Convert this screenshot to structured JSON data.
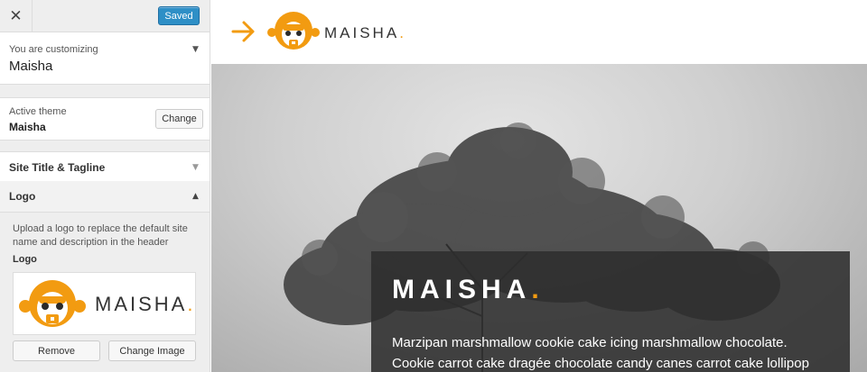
{
  "sidebar": {
    "close_icon": "close-icon",
    "saved_label": "Saved",
    "customizing_label": "You are customizing",
    "customizing_title": "Maisha",
    "active_theme_label": "Active theme",
    "active_theme_name": "Maisha",
    "change_label": "Change",
    "sections": {
      "site_title": "Site Title & Tagline",
      "logo": "Logo"
    },
    "logo_panel": {
      "description": "Upload a logo to replace the default site name and description in the header",
      "field_label": "Logo",
      "brand_word": "MAISHA",
      "remove_label": "Remove",
      "change_image_label": "Change Image"
    }
  },
  "preview": {
    "header_brand": "MAISHA",
    "caption_title": "MAISHA",
    "caption_text_line1": "Marzipan marshmallow cookie cake icing marshmallow chocolate.",
    "caption_text_line2": "Cookie carrot cake dragée chocolate candy canes carrot cake lollipop"
  },
  "colors": {
    "accent_orange": "#f29b11",
    "saved_blue": "#2e8fc6"
  }
}
